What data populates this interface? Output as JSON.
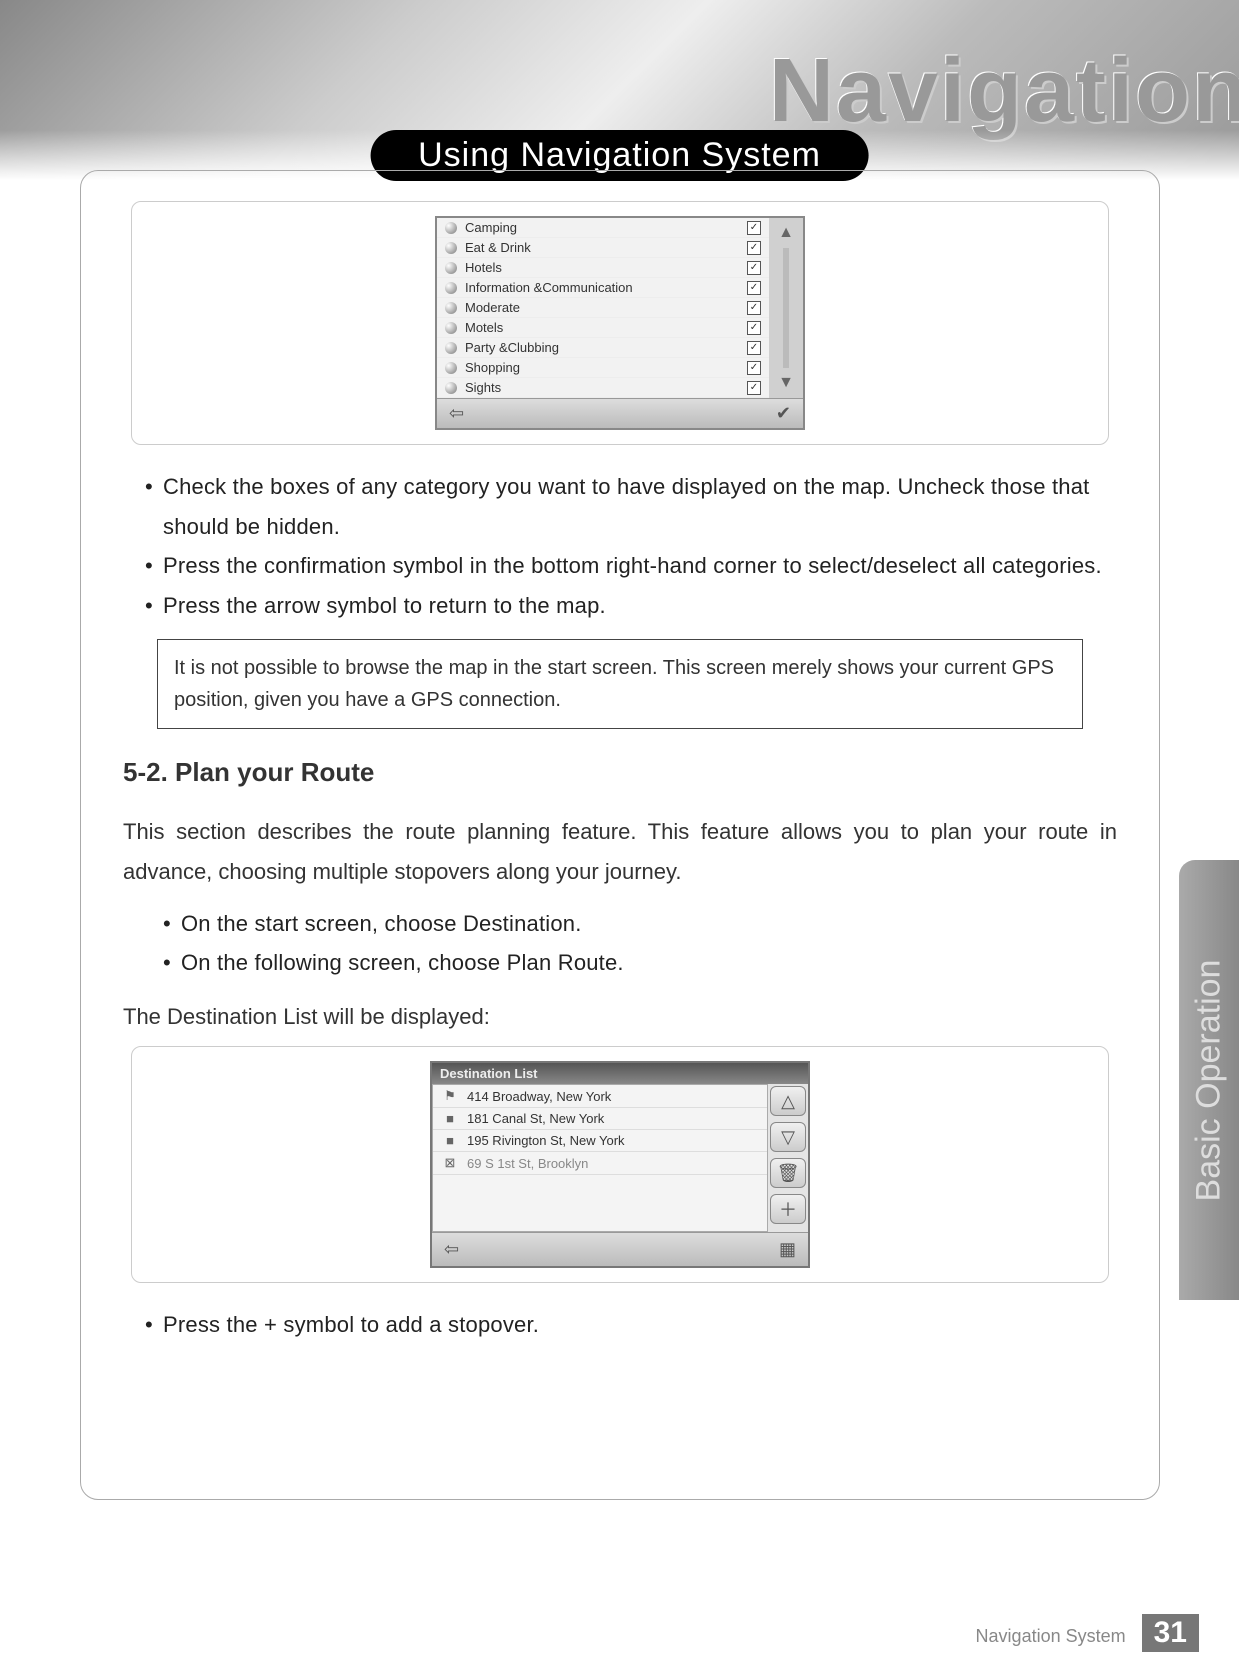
{
  "header": {
    "bg_title": "Navigation",
    "banner": "Using Navigation System"
  },
  "categories_screen": {
    "items": [
      {
        "label": "Camping",
        "checked": true
      },
      {
        "label": "Eat & Drink",
        "checked": true
      },
      {
        "label": "Hotels",
        "checked": true
      },
      {
        "label": "Information &Communication",
        "checked": true
      },
      {
        "label": "Moderate",
        "checked": true
      },
      {
        "label": "Motels",
        "checked": true
      },
      {
        "label": "Party &Clubbing",
        "checked": true
      },
      {
        "label": "Shopping",
        "checked": true
      },
      {
        "label": "Sights",
        "checked": true
      }
    ]
  },
  "bullets_top": [
    "Check the boxes of any category you want to have displayed on the map. Uncheck those that should be hidden.",
    "Press the confirmation symbol in the bottom right-hand corner to select/deselect all categories.",
    "Press the arrow symbol to return to the map."
  ],
  "note": "It is not possible to browse the map in the start screen. This screen merely shows your current GPS position, given you have a GPS connection.",
  "section": {
    "heading": "5-2. Plan your Route",
    "intro": "This section describes the route planning feature. This feature allows you to plan your route in advance, choosing multiple stopovers along your journey.",
    "sub_bullets": [
      "On the start screen, choose Destination.",
      "On the following screen, choose Plan Route."
    ],
    "after_sub": "The Destination List will be displayed:"
  },
  "dest_screen": {
    "title": "Destination List",
    "rows": [
      {
        "kind": "route",
        "text": "414 Broadway, New York"
      },
      {
        "kind": "wp",
        "text": "181 Canal St, New York"
      },
      {
        "kind": "wp",
        "text": "195 Rivington St, New York"
      },
      {
        "kind": "end",
        "text": "69 S 1st St, Brooklyn"
      }
    ]
  },
  "bullets_bottom": [
    "Press the + symbol to add a stopover."
  ],
  "side_tab": "Basic Operation",
  "footer": {
    "label": "Navigation System",
    "page": "31"
  }
}
